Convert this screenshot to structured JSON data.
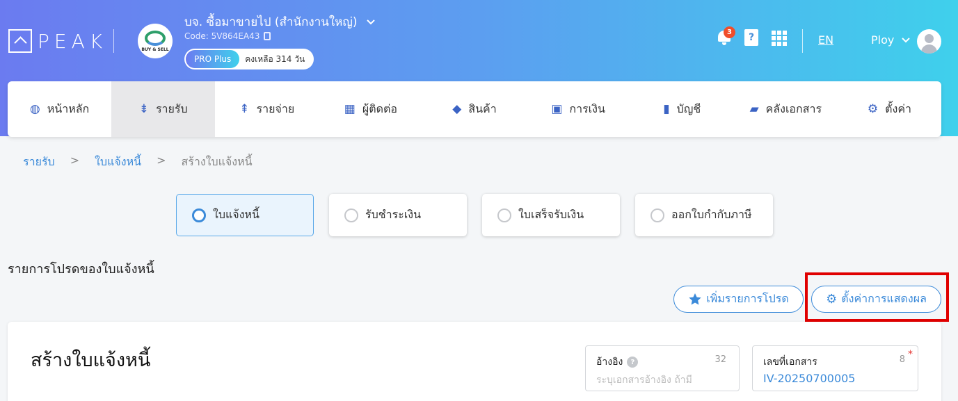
{
  "header": {
    "logo_text": "PEAK",
    "company_name": "บจ. ซื้อมาขายไป (สำนักงานใหญ่)",
    "company_logo_text": "BUY & SELL",
    "company_code": "Code: 5V864EA43",
    "plan": "PRO Plus",
    "plan_remaining": "คงเหลือ 314 วัน",
    "notifications_count": "3",
    "help_glyph": "?",
    "language": "EN",
    "user_name": "Ploy",
    "colors": {
      "gradient_start": "#6b7bf0",
      "gradient_end": "#3fd0ec"
    }
  },
  "nav": {
    "items": [
      {
        "label": "หน้าหลัก",
        "icon": "dashboard-icon",
        "glyph": "◍"
      },
      {
        "label": "รายรับ",
        "icon": "income-icon",
        "glyph": "⇟"
      },
      {
        "label": "รายจ่าย",
        "icon": "expense-icon",
        "glyph": "⇞"
      },
      {
        "label": "ผู้ติดต่อ",
        "icon": "contacts-icon",
        "glyph": "▦"
      },
      {
        "label": "สินค้า",
        "icon": "box-icon",
        "glyph": "◆"
      },
      {
        "label": "การเงิน",
        "icon": "money-icon",
        "glyph": "▣"
      },
      {
        "label": "บัญชี",
        "icon": "ledger-icon",
        "glyph": "▮"
      },
      {
        "label": "คลังเอกสาร",
        "icon": "folder-icon",
        "glyph": "▰"
      },
      {
        "label": "ตั้งค่า",
        "icon": "gear-icon",
        "glyph": "⚙"
      }
    ],
    "active_index": 1
  },
  "breadcrumb": {
    "items": [
      "รายรับ",
      "ใบแจ้งหนี้",
      "สร้างใบแจ้งหนี้"
    ],
    "separator": ">"
  },
  "doc_types": [
    {
      "label": "ใบแจ้งหนี้",
      "selected": true
    },
    {
      "label": "รับชำระเงิน",
      "selected": false
    },
    {
      "label": "ใบเสร็จรับเงิน",
      "selected": false
    },
    {
      "label": "ออกใบกำกับภาษี",
      "selected": false
    }
  ],
  "favorites": {
    "title": "รายการโปรดของใบแจ้งหนี้",
    "add_button": "เพิ่มรายการโปรด",
    "settings_button": "ตั้งค่าการแสดงผล"
  },
  "form": {
    "title": "สร้างใบแจ้งหนี้",
    "reference": {
      "label": "อ้างอิง",
      "count": "32",
      "placeholder": "ระบุเอกสารอ้างอิง ถ้ามี"
    },
    "doc_number": {
      "label": "เลขที่เอกสาร",
      "count": "8",
      "value": "IV-20250700005",
      "required_mark": "*"
    }
  }
}
